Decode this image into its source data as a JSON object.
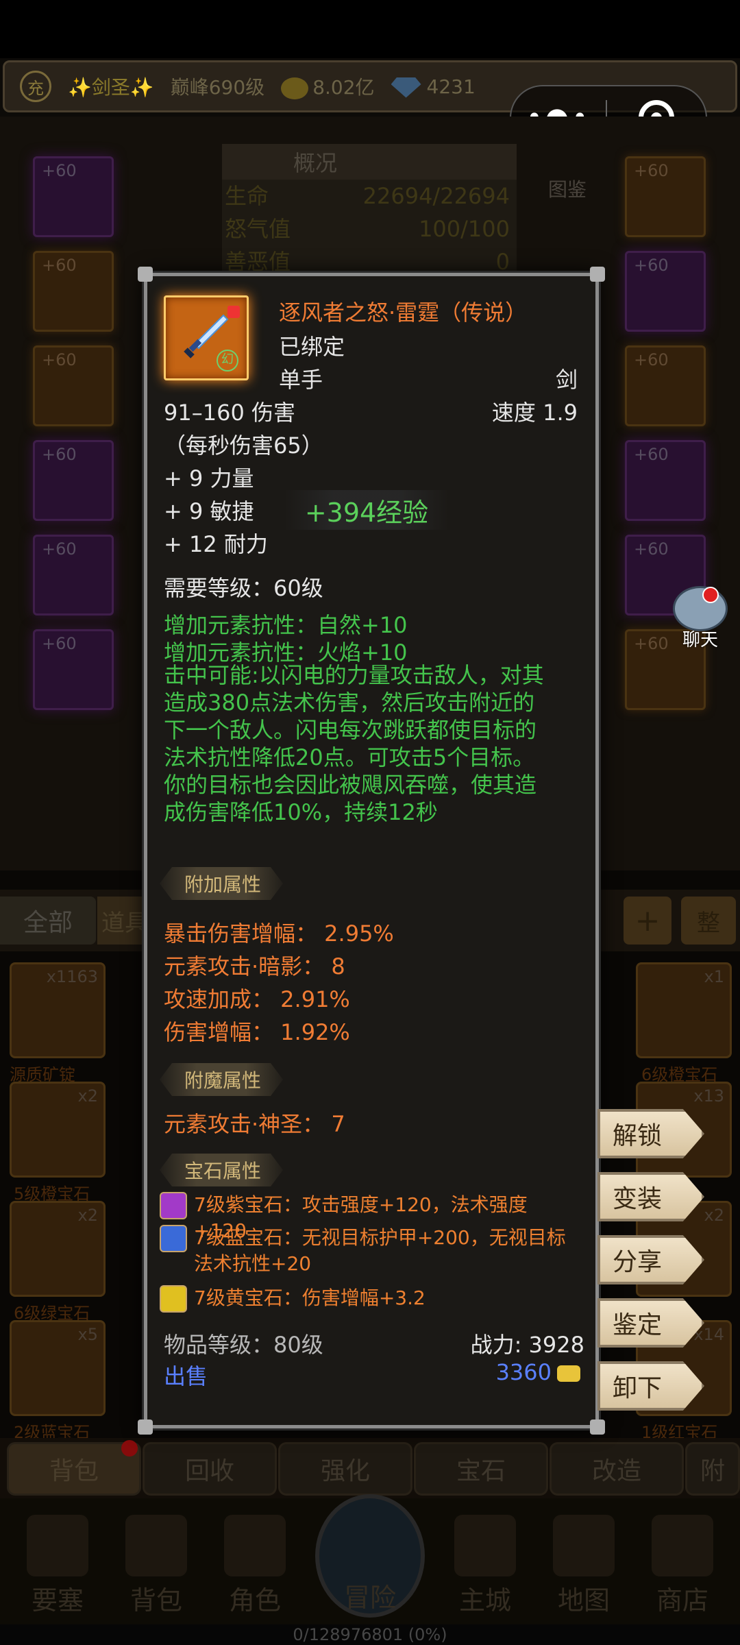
{
  "status_bar": {
    "rebirth_badge": "充",
    "title": "✨剑圣✨",
    "peak_level": "巅峰690级",
    "gold": "8.02亿",
    "diamonds": "4231"
  },
  "mini_program": {
    "more_label": "•●•"
  },
  "overview": {
    "header": "概况",
    "rows": [
      {
        "label": "生命",
        "value": "22694/22694"
      },
      {
        "label": "怒气值",
        "value": "100/100"
      },
      {
        "label": "善恶值",
        "value": "0"
      }
    ],
    "illustration_label": "图鉴"
  },
  "equipment_slots": {
    "left": [
      "+60",
      "+60",
      "+60",
      "+60",
      "+60",
      "+60"
    ],
    "right": [
      "+60",
      "+60",
      "+60",
      "+60",
      "+60",
      "+60"
    ]
  },
  "chat_label": "聊天",
  "categories": {
    "all": "全部",
    "items": "道具",
    "plus": "+",
    "sort": "整"
  },
  "bag": {
    "slots": [
      {
        "count": "x1163",
        "name": "源质矿锭"
      },
      {
        "count": "x1",
        "name": "6级橙宝石"
      },
      {
        "count": "x2",
        "name": "5级橙宝石"
      },
      {
        "count": "x13",
        "name": ""
      },
      {
        "count": "x2",
        "name": "6级绿宝石"
      },
      {
        "count": "x2",
        "name": ""
      },
      {
        "count": "x5",
        "name": "2级蓝宝石"
      },
      {
        "count": "x14",
        "name": "1级红宝石"
      }
    ]
  },
  "tooltip": {
    "name": "逐风者之怒·雷霆（传说）",
    "bound": "已绑定",
    "hand": "单手",
    "weapon_type": "剑",
    "damage": "91–160 伤害",
    "speed": "速度 1.9",
    "dps": "（每秒伤害65）",
    "stats": [
      "+ 9 力量",
      "+ 9 敏捷",
      "+ 12 耐力"
    ],
    "xp_gain": "+394经验",
    "required_level": "需要等级：60级",
    "resist_nature": "增加元素抗性：自然+10",
    "resist_fire": "增加元素抗性：火焰+10",
    "proc": "击中可能:以闪电的力量攻击敌人，对其造成380点法术伤害，然后攻击附近的下一个敌人。闪电每次跳跃都使目标的法术抗性降低20点。可攻击5个目标。你的目标也会因此被飓风吞噬，使其造成伤害降低10%，持续12秒",
    "extra_header": "附加属性",
    "extra": [
      "暴击伤害增幅：  2.95%",
      "元素攻击·暗影：  8",
      "攻速加成：  2.91%",
      "伤害增幅：  1.92%"
    ],
    "enchant_header": "附魔属性",
    "enchant": "元素攻击·神圣：  7",
    "gem_header": "宝石属性",
    "gems": [
      {
        "color": "#a23ac8",
        "text": "7级紫宝石：攻击强度+120，法术强度+120"
      },
      {
        "color": "#3a6ad8",
        "text": "7级蓝宝石：无视目标护甲+200，无视目标法术抗性+20"
      },
      {
        "color": "#e0c020",
        "text": "7级黄宝石：伤害增幅+3.2"
      }
    ],
    "item_level": "物品等级：80级",
    "combat_power": "战力: 3928",
    "sell": "出售",
    "price": "3360"
  },
  "actions": [
    "解锁",
    "变装",
    "分享",
    "鉴定",
    "卸下"
  ],
  "tabs": [
    "背包",
    "回收",
    "强化",
    "宝石",
    "改造",
    "附"
  ],
  "nav": [
    "要塞",
    "背包",
    "角色",
    "冒险",
    "主城",
    "地图",
    "商店"
  ],
  "xp_bar": "0/128976801 (0%)"
}
